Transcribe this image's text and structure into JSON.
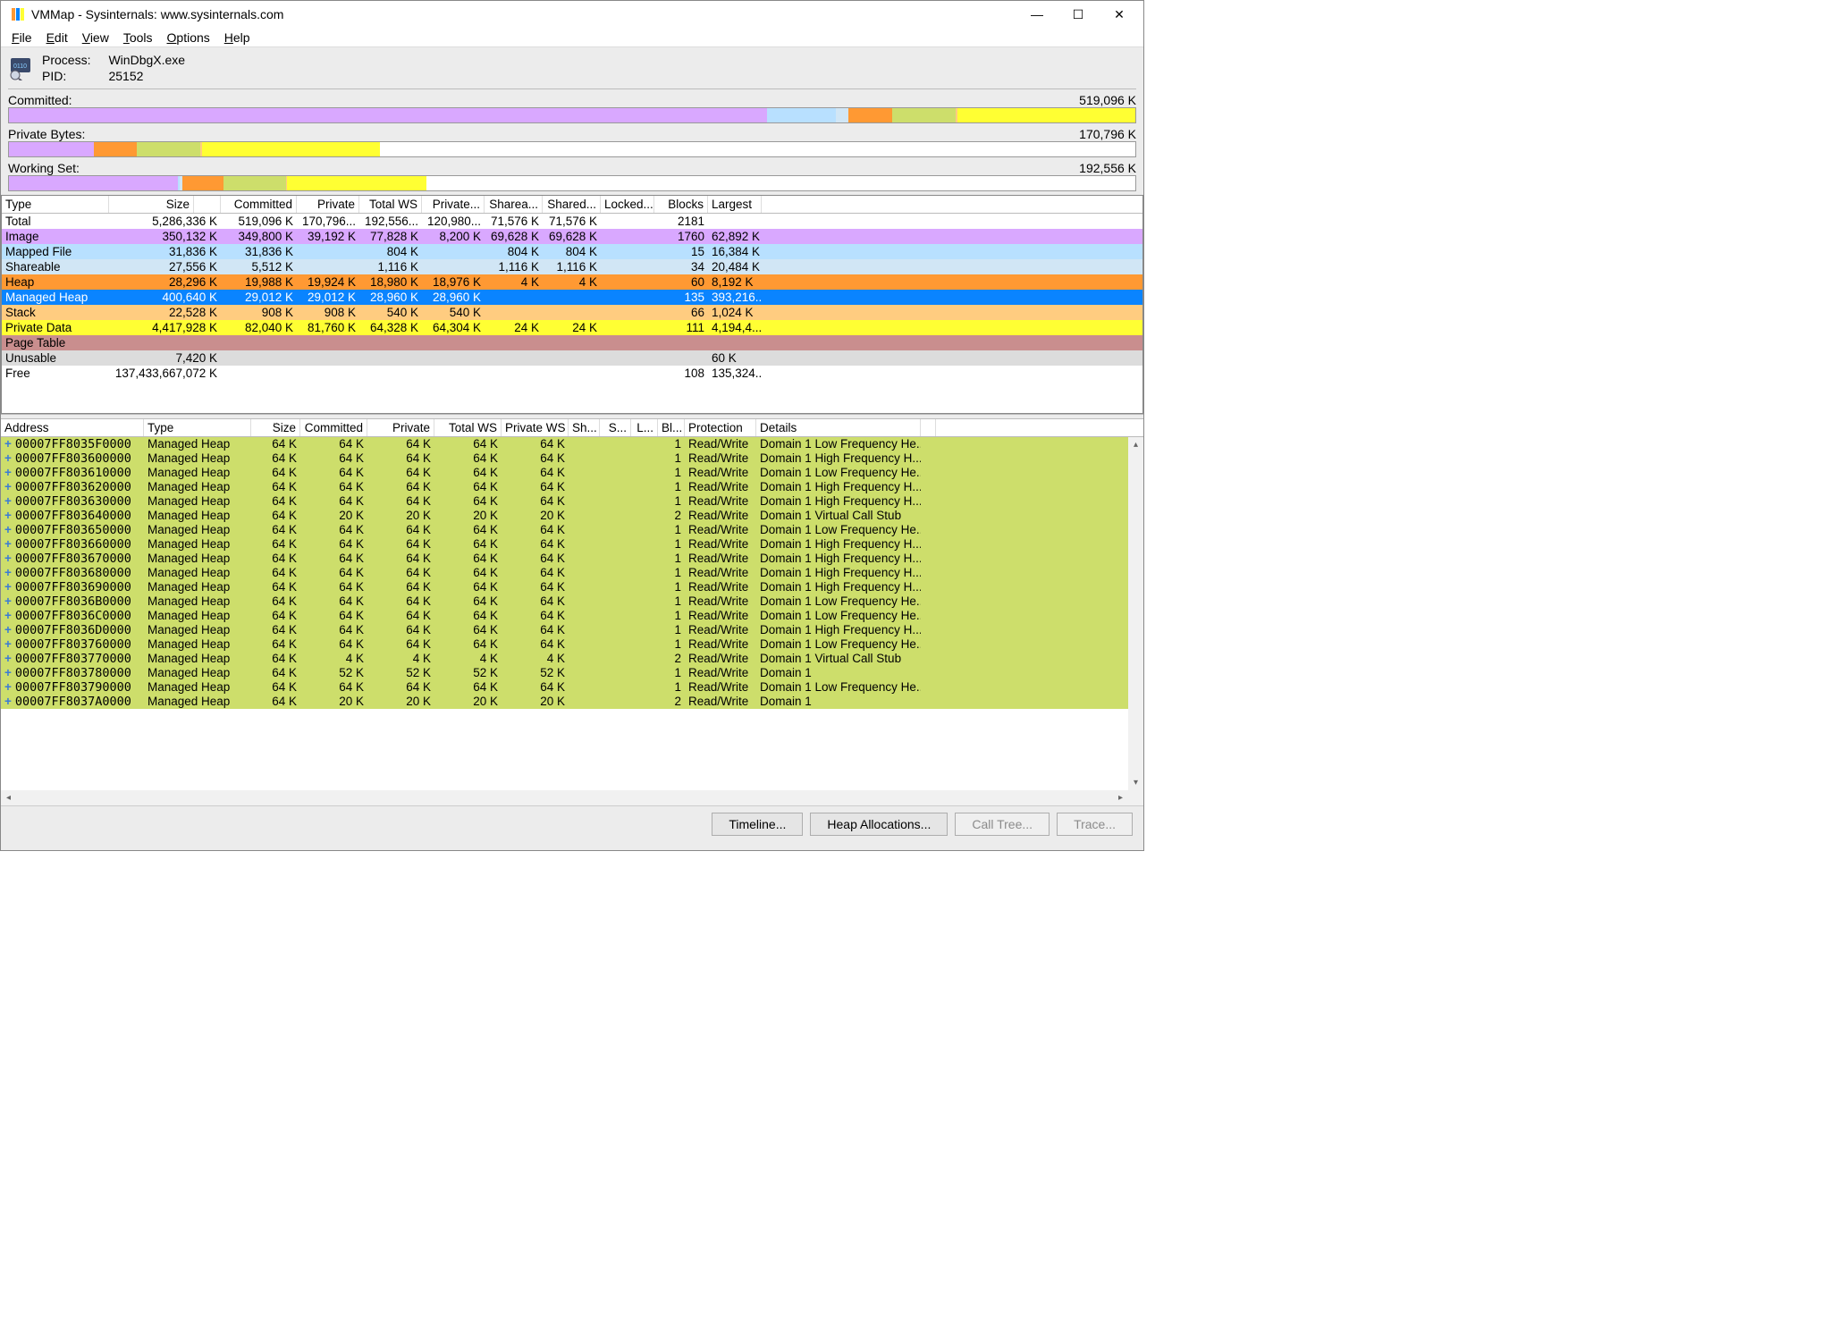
{
  "title": "VMMap - Sysinternals: www.sysinternals.com",
  "menubar": [
    "File",
    "Edit",
    "View",
    "Tools",
    "Options",
    "Help"
  ],
  "process": {
    "label_process": "Process:",
    "label_pid": "PID:",
    "name": "WinDbgX.exe",
    "pid": "25152"
  },
  "bars": [
    {
      "label": "Committed:",
      "value": "519,096 K"
    },
    {
      "label": "Private Bytes:",
      "value": "170,796 K"
    },
    {
      "label": "Working Set:",
      "value": "192,556 K"
    }
  ],
  "summary_headers": [
    "Type",
    "Size",
    "",
    "Committed",
    "Private",
    "Total WS",
    "Private...",
    "Sharea...",
    "Shared...",
    "Locked...",
    "Blocks",
    "Largest"
  ],
  "summary_rows": [
    {
      "class": "",
      "cells": [
        "Total",
        "5,286,336 K",
        "519,096 K",
        "170,796...",
        "192,556...",
        "120,980...",
        "71,576 K",
        "71,576 K",
        "",
        "2181",
        ""
      ]
    },
    {
      "class": "c-image",
      "cells": [
        "Image",
        "350,132 K",
        "349,800 K",
        "39,192 K",
        "77,828 K",
        "8,200 K",
        "69,628 K",
        "69,628 K",
        "",
        "1760",
        "62,892 K"
      ]
    },
    {
      "class": "c-mapped",
      "cells": [
        "Mapped File",
        "31,836 K",
        "31,836 K",
        "",
        "804 K",
        "",
        "804 K",
        "804 K",
        "",
        "15",
        "16,384 K"
      ]
    },
    {
      "class": "c-share",
      "cells": [
        "Shareable",
        "27,556 K",
        "5,512 K",
        "",
        "1,116 K",
        "",
        "1,116 K",
        "1,116 K",
        "",
        "34",
        "20,484 K"
      ]
    },
    {
      "class": "c-heap",
      "cells": [
        "Heap",
        "28,296 K",
        "19,988 K",
        "19,924 K",
        "18,980 K",
        "18,976 K",
        "4 K",
        "4 K",
        "",
        "60",
        "8,192 K"
      ]
    },
    {
      "class": "c-mheap-sel",
      "cells": [
        "Managed Heap",
        "400,640 K",
        "29,012 K",
        "29,012 K",
        "28,960 K",
        "28,960 K",
        "",
        "",
        "",
        "135",
        "393,216..."
      ]
    },
    {
      "class": "c-stack",
      "cells": [
        "Stack",
        "22,528 K",
        "908 K",
        "908 K",
        "540 K",
        "540 K",
        "",
        "",
        "",
        "66",
        "1,024 K"
      ]
    },
    {
      "class": "c-priv",
      "cells": [
        "Private Data",
        "4,417,928 K",
        "82,040 K",
        "81,760 K",
        "64,328 K",
        "64,304 K",
        "24 K",
        "24 K",
        "",
        "111",
        "4,194,4..."
      ]
    },
    {
      "class": "c-page",
      "cells": [
        "Page Table",
        "",
        "",
        "",
        "",
        "",
        "",
        "",
        "",
        "",
        ""
      ]
    },
    {
      "class": "c-unuse",
      "cells": [
        "Unusable",
        "7,420 K",
        "",
        "",
        "",
        "",
        "",
        "",
        "",
        "",
        "60 K"
      ]
    },
    {
      "class": "c-free",
      "cells": [
        "Free",
        "137,433,667,072 K",
        "",
        "",
        "",
        "",
        "",
        "",
        "",
        "108",
        "135,324..."
      ]
    }
  ],
  "detail_headers": [
    "Address",
    "Type",
    "Size",
    "Committed",
    "Private",
    "Total WS",
    "Private WS",
    "Sh...",
    "S...",
    "L...",
    "Bl...",
    "Protection",
    "Details"
  ],
  "detail_rows": [
    {
      "addr": "00007FF8035F0000",
      "type": "Managed Heap",
      "size": "64 K",
      "committed": "64 K",
      "private": "64 K",
      "totalws": "64 K",
      "pws": "64 K",
      "bl": "1",
      "prot": "Read/Write",
      "details": "Domain 1 Low Frequency He..."
    },
    {
      "addr": "00007FF803600000",
      "type": "Managed Heap",
      "size": "64 K",
      "committed": "64 K",
      "private": "64 K",
      "totalws": "64 K",
      "pws": "64 K",
      "bl": "1",
      "prot": "Read/Write",
      "details": "Domain 1 High Frequency H..."
    },
    {
      "addr": "00007FF803610000",
      "type": "Managed Heap",
      "size": "64 K",
      "committed": "64 K",
      "private": "64 K",
      "totalws": "64 K",
      "pws": "64 K",
      "bl": "1",
      "prot": "Read/Write",
      "details": "Domain 1 Low Frequency He..."
    },
    {
      "addr": "00007FF803620000",
      "type": "Managed Heap",
      "size": "64 K",
      "committed": "64 K",
      "private": "64 K",
      "totalws": "64 K",
      "pws": "64 K",
      "bl": "1",
      "prot": "Read/Write",
      "details": "Domain 1 High Frequency H..."
    },
    {
      "addr": "00007FF803630000",
      "type": "Managed Heap",
      "size": "64 K",
      "committed": "64 K",
      "private": "64 K",
      "totalws": "64 K",
      "pws": "64 K",
      "bl": "1",
      "prot": "Read/Write",
      "details": "Domain 1 High Frequency H..."
    },
    {
      "addr": "00007FF803640000",
      "type": "Managed Heap",
      "size": "64 K",
      "committed": "20 K",
      "private": "20 K",
      "totalws": "20 K",
      "pws": "20 K",
      "bl": "2",
      "prot": "Read/Write",
      "details": "Domain 1 Virtual Call Stub"
    },
    {
      "addr": "00007FF803650000",
      "type": "Managed Heap",
      "size": "64 K",
      "committed": "64 K",
      "private": "64 K",
      "totalws": "64 K",
      "pws": "64 K",
      "bl": "1",
      "prot": "Read/Write",
      "details": "Domain 1 Low Frequency He..."
    },
    {
      "addr": "00007FF803660000",
      "type": "Managed Heap",
      "size": "64 K",
      "committed": "64 K",
      "private": "64 K",
      "totalws": "64 K",
      "pws": "64 K",
      "bl": "1",
      "prot": "Read/Write",
      "details": "Domain 1 High Frequency H..."
    },
    {
      "addr": "00007FF803670000",
      "type": "Managed Heap",
      "size": "64 K",
      "committed": "64 K",
      "private": "64 K",
      "totalws": "64 K",
      "pws": "64 K",
      "bl": "1",
      "prot": "Read/Write",
      "details": "Domain 1 High Frequency H..."
    },
    {
      "addr": "00007FF803680000",
      "type": "Managed Heap",
      "size": "64 K",
      "committed": "64 K",
      "private": "64 K",
      "totalws": "64 K",
      "pws": "64 K",
      "bl": "1",
      "prot": "Read/Write",
      "details": "Domain 1 High Frequency H..."
    },
    {
      "addr": "00007FF803690000",
      "type": "Managed Heap",
      "size": "64 K",
      "committed": "64 K",
      "private": "64 K",
      "totalws": "64 K",
      "pws": "64 K",
      "bl": "1",
      "prot": "Read/Write",
      "details": "Domain 1 High Frequency H..."
    },
    {
      "addr": "00007FF8036B0000",
      "type": "Managed Heap",
      "size": "64 K",
      "committed": "64 K",
      "private": "64 K",
      "totalws": "64 K",
      "pws": "64 K",
      "bl": "1",
      "prot": "Read/Write",
      "details": "Domain 1 Low Frequency He..."
    },
    {
      "addr": "00007FF8036C0000",
      "type": "Managed Heap",
      "size": "64 K",
      "committed": "64 K",
      "private": "64 K",
      "totalws": "64 K",
      "pws": "64 K",
      "bl": "1",
      "prot": "Read/Write",
      "details": "Domain 1 Low Frequency He..."
    },
    {
      "addr": "00007FF8036D0000",
      "type": "Managed Heap",
      "size": "64 K",
      "committed": "64 K",
      "private": "64 K",
      "totalws": "64 K",
      "pws": "64 K",
      "bl": "1",
      "prot": "Read/Write",
      "details": "Domain 1 High Frequency H..."
    },
    {
      "addr": "00007FF803760000",
      "type": "Managed Heap",
      "size": "64 K",
      "committed": "64 K",
      "private": "64 K",
      "totalws": "64 K",
      "pws": "64 K",
      "bl": "1",
      "prot": "Read/Write",
      "details": "Domain 1 Low Frequency He..."
    },
    {
      "addr": "00007FF803770000",
      "type": "Managed Heap",
      "size": "64 K",
      "committed": "4 K",
      "private": "4 K",
      "totalws": "4 K",
      "pws": "4 K",
      "bl": "2",
      "prot": "Read/Write",
      "details": "Domain 1 Virtual Call Stub"
    },
    {
      "addr": "00007FF803780000",
      "type": "Managed Heap",
      "size": "64 K",
      "committed": "52 K",
      "private": "52 K",
      "totalws": "52 K",
      "pws": "52 K",
      "bl": "1",
      "prot": "Read/Write",
      "details": "Domain 1"
    },
    {
      "addr": "00007FF803790000",
      "type": "Managed Heap",
      "size": "64 K",
      "committed": "64 K",
      "private": "64 K",
      "totalws": "64 K",
      "pws": "64 K",
      "bl": "1",
      "prot": "Read/Write",
      "details": "Domain 1 Low Frequency He..."
    },
    {
      "addr": "00007FF8037A0000",
      "type": "Managed Heap",
      "size": "64 K",
      "committed": "20 K",
      "private": "20 K",
      "totalws": "20 K",
      "pws": "20 K",
      "bl": "2",
      "prot": "Read/Write",
      "details": "Domain 1"
    }
  ],
  "buttons": {
    "timeline": "Timeline...",
    "heap": "Heap Allocations...",
    "calltree": "Call Tree...",
    "trace": "Trace..."
  },
  "committed_bar": [
    {
      "cls": "c-image",
      "pct": 67.4
    },
    {
      "cls": "c-mapped",
      "pct": 6.1
    },
    {
      "cls": "c-share",
      "pct": 1.1
    },
    {
      "cls": "c-heap",
      "pct": 3.9
    },
    {
      "cls": "c-mheap",
      "pct": 5.6
    },
    {
      "cls": "c-stack",
      "pct": 0.2
    },
    {
      "cls": "c-priv",
      "pct": 15.8
    }
  ],
  "private_bar": [
    {
      "cls": "c-image",
      "pct": 22.9
    },
    {
      "cls": "c-heap",
      "pct": 11.7
    },
    {
      "cls": "c-mheap",
      "pct": 17.0
    },
    {
      "cls": "c-stack",
      "pct": 0.5
    },
    {
      "cls": "c-priv",
      "pct": 47.9
    }
  ],
  "private_fill_pct": 32.9,
  "ws_bar": [
    {
      "cls": "c-image",
      "pct": 40.4
    },
    {
      "cls": "c-mapped",
      "pct": 0.4
    },
    {
      "cls": "c-share",
      "pct": 0.6
    },
    {
      "cls": "c-heap",
      "pct": 9.9
    },
    {
      "cls": "c-mheap",
      "pct": 15.0
    },
    {
      "cls": "c-stack",
      "pct": 0.3
    },
    {
      "cls": "c-priv",
      "pct": 33.4
    }
  ],
  "ws_fill_pct": 37.1
}
